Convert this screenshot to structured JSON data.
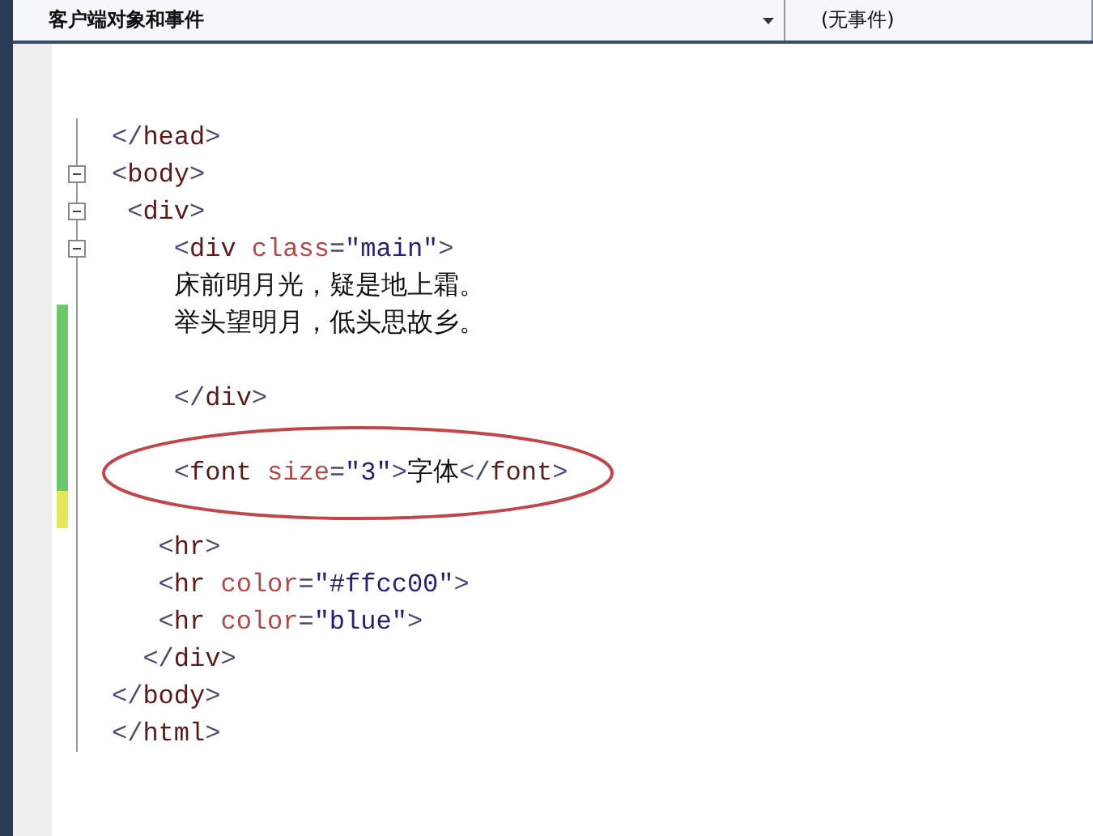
{
  "navigation_bar": {
    "object_dropdown": {
      "value": "客户端对象和事件"
    },
    "event_dropdown": {
      "value": "(无事件)"
    }
  },
  "editor": {
    "lines": [
      {
        "tokens": [
          {
            "kind": "delim",
            "text": "</"
          },
          {
            "kind": "tag",
            "text": "head"
          },
          {
            "kind": "delim",
            "text": ">"
          }
        ]
      },
      {
        "expanded": true,
        "tokens": [
          {
            "kind": "delim",
            "text": "<"
          },
          {
            "kind": "tag",
            "text": "body"
          },
          {
            "kind": "delim",
            "text": ">"
          }
        ]
      },
      {
        "expanded": true,
        "tokens": [
          {
            "kind": "delim",
            "text": " <"
          },
          {
            "kind": "tag",
            "text": "div"
          },
          {
            "kind": "delim",
            "text": ">"
          }
        ]
      },
      {
        "expanded": true,
        "tokens": [
          {
            "kind": "delim",
            "text": "    <"
          },
          {
            "kind": "tag",
            "text": "div"
          },
          {
            "kind": "attr",
            "text": " class"
          },
          {
            "kind": "delim",
            "text": "="
          },
          {
            "kind": "value",
            "text": "\"main\""
          },
          {
            "kind": "delim",
            "text": ">"
          }
        ]
      },
      {
        "tokens": [
          {
            "kind": "text",
            "text": "    床前明月光，疑是地上霜。"
          }
        ]
      },
      {
        "color": "#6cc86c",
        "tokens": [
          {
            "kind": "text",
            "text": "    举头望明月，低头思故乡。"
          }
        ]
      },
      {
        "color": "#6cc86c"
      },
      {
        "color": "#6cc86c",
        "tokens": [
          {
            "kind": "delim",
            "text": "    </"
          },
          {
            "kind": "tag",
            "text": "div"
          },
          {
            "kind": "delim",
            "text": ">"
          }
        ]
      },
      {
        "color": "#6cc86c"
      },
      {
        "color": "#6cc86c",
        "circled": true,
        "tokens": [
          {
            "kind": "delim",
            "text": "    <"
          },
          {
            "kind": "tag",
            "text": "font"
          },
          {
            "kind": "attr",
            "text": " size"
          },
          {
            "kind": "delim",
            "text": "="
          },
          {
            "kind": "value",
            "text": "\"3\""
          },
          {
            "kind": "delim",
            "text": ">"
          },
          {
            "kind": "text",
            "text": "字体"
          },
          {
            "kind": "delim",
            "text": "</"
          },
          {
            "kind": "tag",
            "text": "font"
          },
          {
            "kind": "delim",
            "text": ">"
          }
        ]
      },
      {
        "color": "#e6e65a"
      },
      {
        "tokens": [
          {
            "kind": "delim",
            "text": "   <"
          },
          {
            "kind": "tag",
            "text": "hr"
          },
          {
            "kind": "delim",
            "text": ">"
          }
        ]
      },
      {
        "tokens": [
          {
            "kind": "delim",
            "text": "   <"
          },
          {
            "kind": "tag",
            "text": "hr"
          },
          {
            "kind": "attr",
            "text": " color"
          },
          {
            "kind": "delim",
            "text": "="
          },
          {
            "kind": "value",
            "text": "\"#ffcc00\""
          },
          {
            "kind": "delim",
            "text": ">"
          }
        ]
      },
      {
        "tokens": [
          {
            "kind": "delim",
            "text": "   <"
          },
          {
            "kind": "tag",
            "text": "hr"
          },
          {
            "kind": "attr",
            "text": " color"
          },
          {
            "kind": "delim",
            "text": "="
          },
          {
            "kind": "value",
            "text": "\"blue\""
          },
          {
            "kind": "delim",
            "text": ">"
          }
        ]
      },
      {
        "tokens": [
          {
            "kind": "delim",
            "text": "  </"
          },
          {
            "kind": "tag",
            "text": "div"
          },
          {
            "kind": "delim",
            "text": ">"
          }
        ]
      },
      {
        "tokens": [
          {
            "kind": "delim",
            "text": "</"
          },
          {
            "kind": "tag",
            "text": "body"
          },
          {
            "kind": "delim",
            "text": ">"
          }
        ]
      },
      {
        "tokens": [
          {
            "kind": "delim",
            "text": "</"
          },
          {
            "kind": "tag",
            "text": "html"
          },
          {
            "kind": "delim",
            "text": ">"
          }
        ]
      }
    ]
  }
}
